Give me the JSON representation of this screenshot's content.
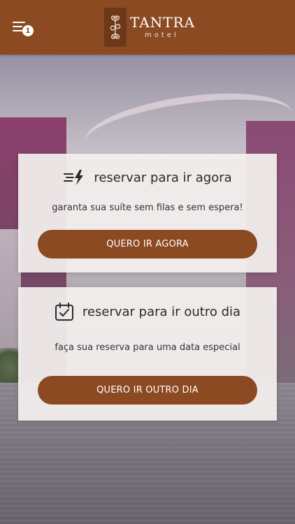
{
  "header": {
    "menu_badge": "1",
    "logo_word": "TANTRA",
    "logo_sub": "motel",
    "brand_color": "#8b4a22"
  },
  "cards": {
    "now": {
      "icon": "lightning-speed-icon",
      "title": "reservar para ir agora",
      "subtitle": "garanta sua suíte sem filas e sem espera!",
      "button": "QUERO IR AGORA"
    },
    "other": {
      "icon": "calendar-check-icon",
      "title": "reservar para ir outro dia",
      "subtitle": "faça sua reserva para uma data especial",
      "button": "QUERO IR OUTRO DIA"
    }
  }
}
